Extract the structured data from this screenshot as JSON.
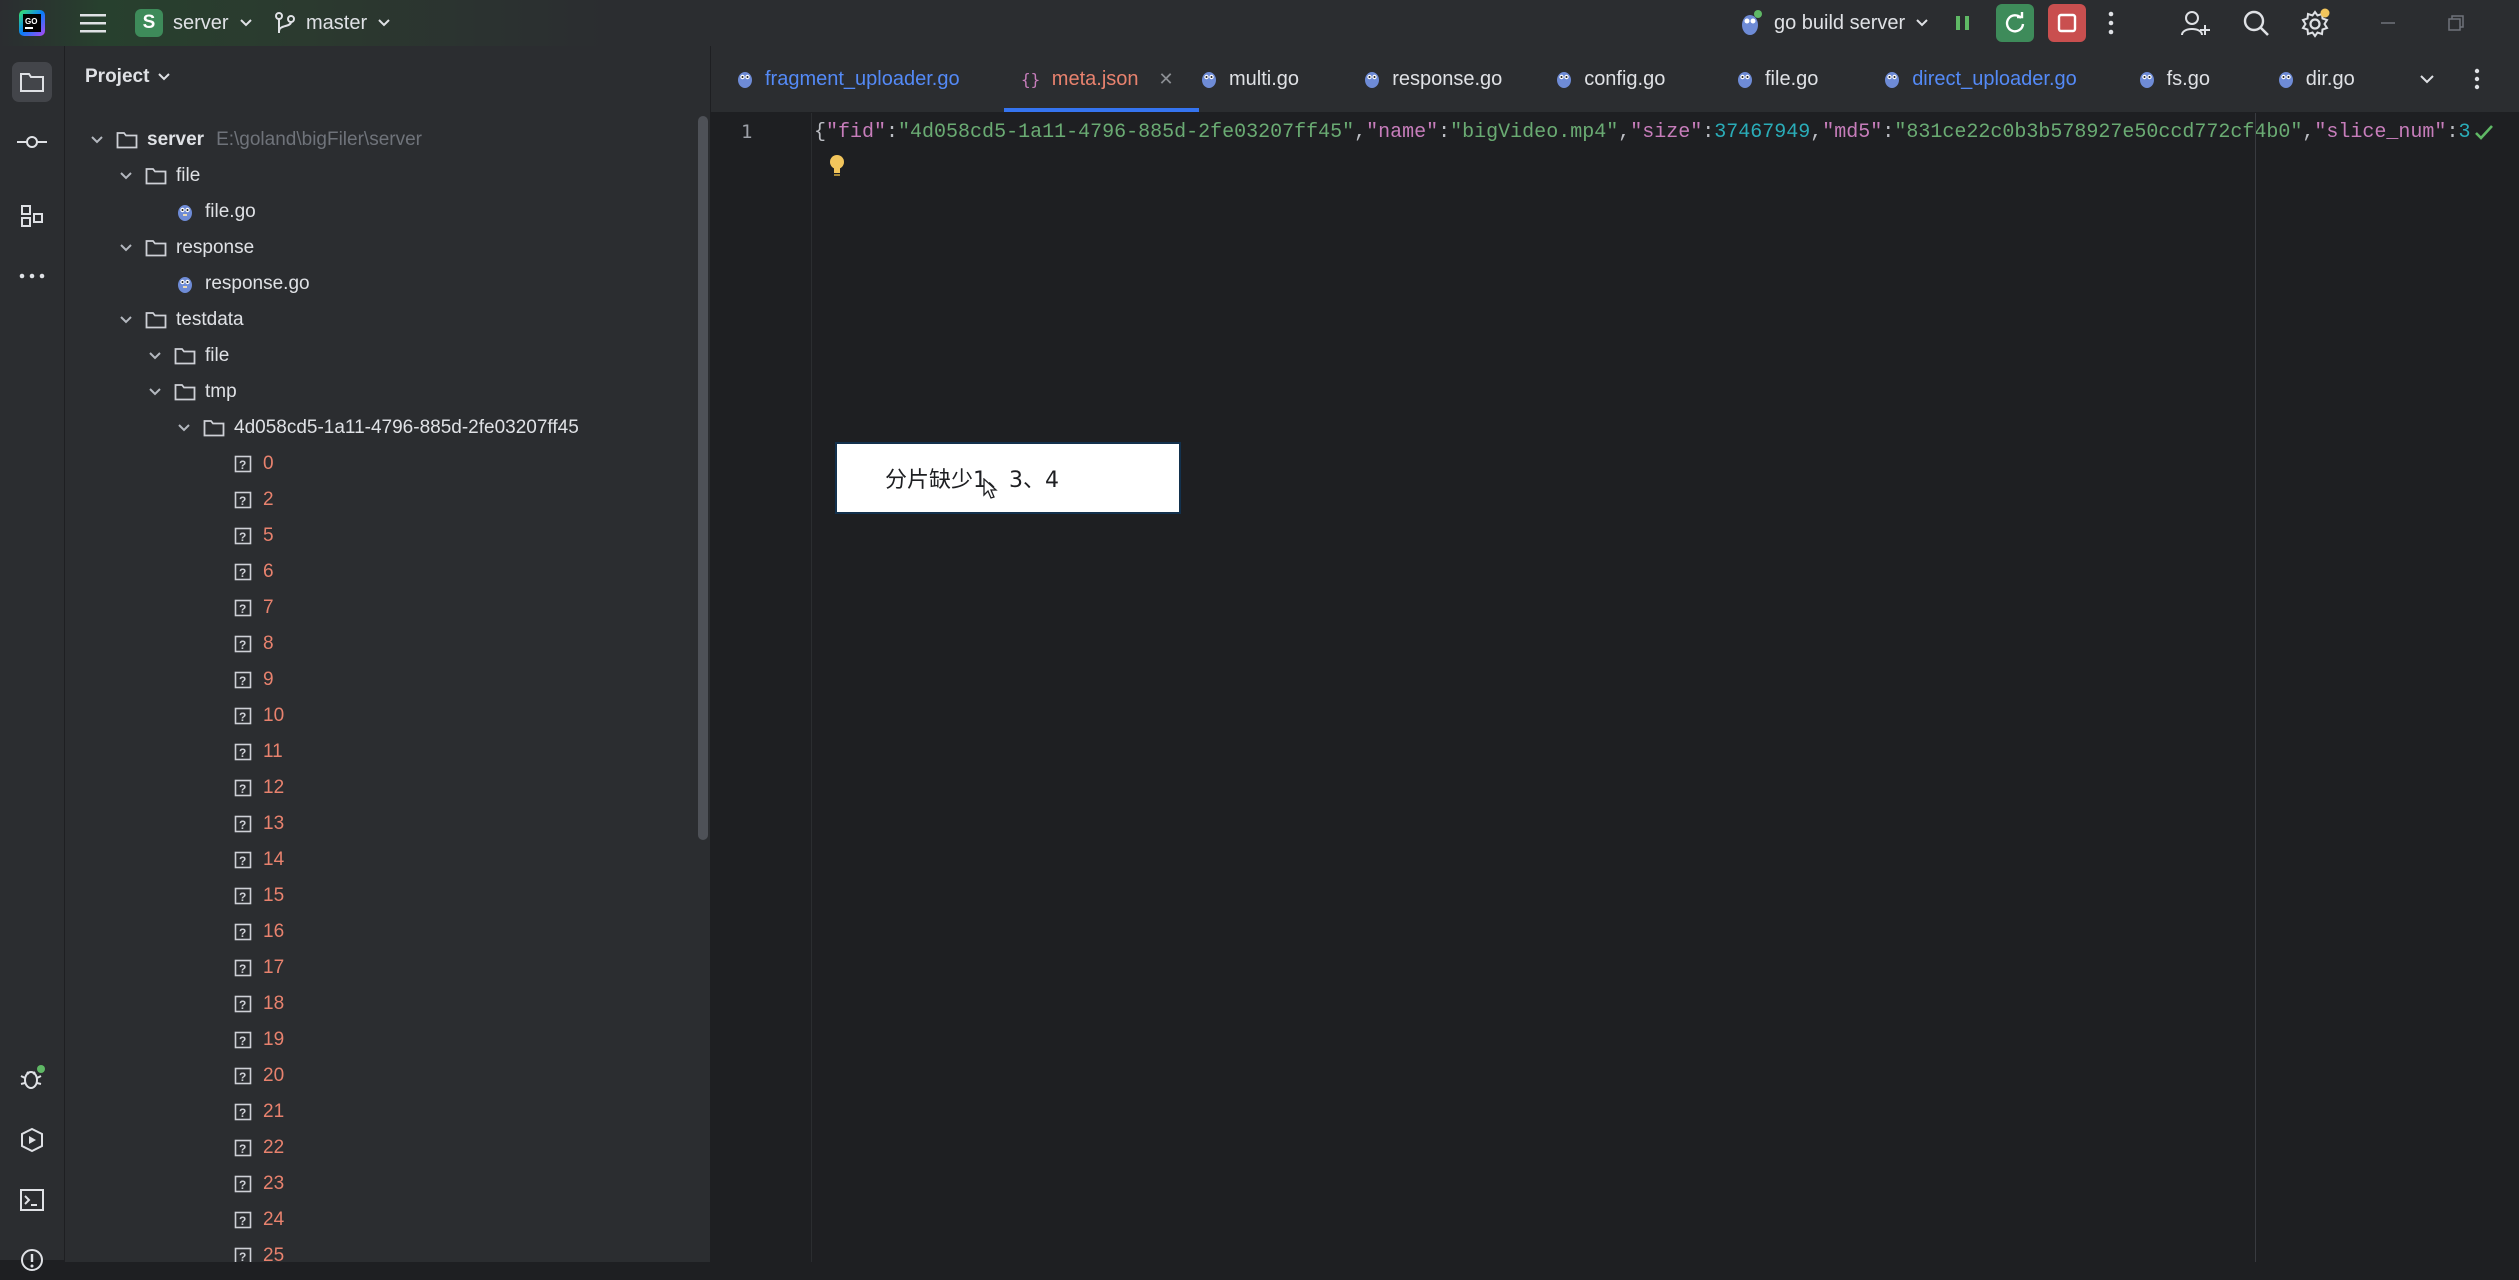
{
  "titlebar": {
    "project_badge": "S",
    "project_name": "server",
    "branch": "master",
    "run_config": "go build server"
  },
  "project_panel": {
    "title": "Project",
    "tree": [
      {
        "label": "server",
        "path": "E:\\goland\\bigFiler\\server",
        "type": "folder",
        "level": 0,
        "expanded": true,
        "bold": true
      },
      {
        "label": "file",
        "type": "folder",
        "level": 1,
        "expanded": true
      },
      {
        "label": "file.go",
        "type": "go",
        "level": 2
      },
      {
        "label": "response",
        "type": "folder",
        "level": 1,
        "expanded": true
      },
      {
        "label": "response.go",
        "type": "go",
        "level": 2
      },
      {
        "label": "testdata",
        "type": "folder",
        "level": 1,
        "expanded": true
      },
      {
        "label": "file",
        "type": "folder",
        "level": 2,
        "expanded": true
      },
      {
        "label": "tmp",
        "type": "folder",
        "level": 2,
        "expanded": true
      },
      {
        "label": "4d058cd5-1a11-4796-885d-2fe03207ff45",
        "type": "folder",
        "level": 3,
        "expanded": true
      },
      {
        "label": "0",
        "type": "unknown",
        "level": 4
      },
      {
        "label": "2",
        "type": "unknown",
        "level": 4
      },
      {
        "label": "5",
        "type": "unknown",
        "level": 4
      },
      {
        "label": "6",
        "type": "unknown",
        "level": 4
      },
      {
        "label": "7",
        "type": "unknown",
        "level": 4
      },
      {
        "label": "8",
        "type": "unknown",
        "level": 4
      },
      {
        "label": "9",
        "type": "unknown",
        "level": 4
      },
      {
        "label": "10",
        "type": "unknown",
        "level": 4
      },
      {
        "label": "11",
        "type": "unknown",
        "level": 4
      },
      {
        "label": "12",
        "type": "unknown",
        "level": 4
      },
      {
        "label": "13",
        "type": "unknown",
        "level": 4
      },
      {
        "label": "14",
        "type": "unknown",
        "level": 4
      },
      {
        "label": "15",
        "type": "unknown",
        "level": 4
      },
      {
        "label": "16",
        "type": "unknown",
        "level": 4
      },
      {
        "label": "17",
        "type": "unknown",
        "level": 4
      },
      {
        "label": "18",
        "type": "unknown",
        "level": 4
      },
      {
        "label": "19",
        "type": "unknown",
        "level": 4
      },
      {
        "label": "20",
        "type": "unknown",
        "level": 4
      },
      {
        "label": "21",
        "type": "unknown",
        "level": 4
      },
      {
        "label": "22",
        "type": "unknown",
        "level": 4
      },
      {
        "label": "23",
        "type": "unknown",
        "level": 4
      },
      {
        "label": "24",
        "type": "unknown",
        "level": 4
      },
      {
        "label": "25",
        "type": "unknown",
        "level": 4
      }
    ]
  },
  "tabs": [
    {
      "label": "fragment_uploader.go",
      "type": "go",
      "color": "#548af7"
    },
    {
      "label": "meta.json",
      "type": "json",
      "color": "#e8826e",
      "active": true
    },
    {
      "label": "multi.go",
      "type": "go",
      "color": "#dfe1e5"
    },
    {
      "label": "response.go",
      "type": "go",
      "color": "#dfe1e5"
    },
    {
      "label": "config.go",
      "type": "go",
      "color": "#dfe1e5"
    },
    {
      "label": "file.go",
      "type": "go",
      "color": "#dfe1e5"
    },
    {
      "label": "direct_uploader.go",
      "type": "go",
      "color": "#548af7"
    },
    {
      "label": "fs.go",
      "type": "go",
      "color": "#dfe1e5"
    },
    {
      "label": "dir.go",
      "type": "go",
      "color": "#dfe1e5"
    }
  ],
  "editor": {
    "line_number": "1",
    "tokens": [
      {
        "t": "{",
        "c": "p"
      },
      {
        "t": "\"fid\"",
        "c": "k"
      },
      {
        "t": ":",
        "c": "p"
      },
      {
        "t": "\"4d058cd5-1a11-4796-885d-2fe03207ff45\"",
        "c": "s"
      },
      {
        "t": ",",
        "c": "p"
      },
      {
        "t": "\"name\"",
        "c": "k"
      },
      {
        "t": ":",
        "c": "p"
      },
      {
        "t": "\"bigVideo.mp4\"",
        "c": "s"
      },
      {
        "t": ",",
        "c": "p"
      },
      {
        "t": "\"size\"",
        "c": "k"
      },
      {
        "t": ":",
        "c": "p"
      },
      {
        "t": "37467949",
        "c": "n"
      },
      {
        "t": ",",
        "c": "p"
      },
      {
        "t": "\"md5\"",
        "c": "k"
      },
      {
        "t": ":",
        "c": "p"
      },
      {
        "t": "\"831ce22c0b3b578927e50ccd772cf4b0\"",
        "c": "s"
      },
      {
        "t": ",",
        "c": "p"
      },
      {
        "t": "\"slice_num\"",
        "c": "k"
      },
      {
        "t": ":",
        "c": "p"
      },
      {
        "t": "3",
        "c": "n"
      }
    ]
  },
  "overlay": {
    "text": "分片缺少1、3、4"
  },
  "colors": {
    "accent": "#3574f0",
    "unversioned": "#e8826e",
    "run_green": "#3e8b5a",
    "stop_red": "#c94f4f"
  }
}
